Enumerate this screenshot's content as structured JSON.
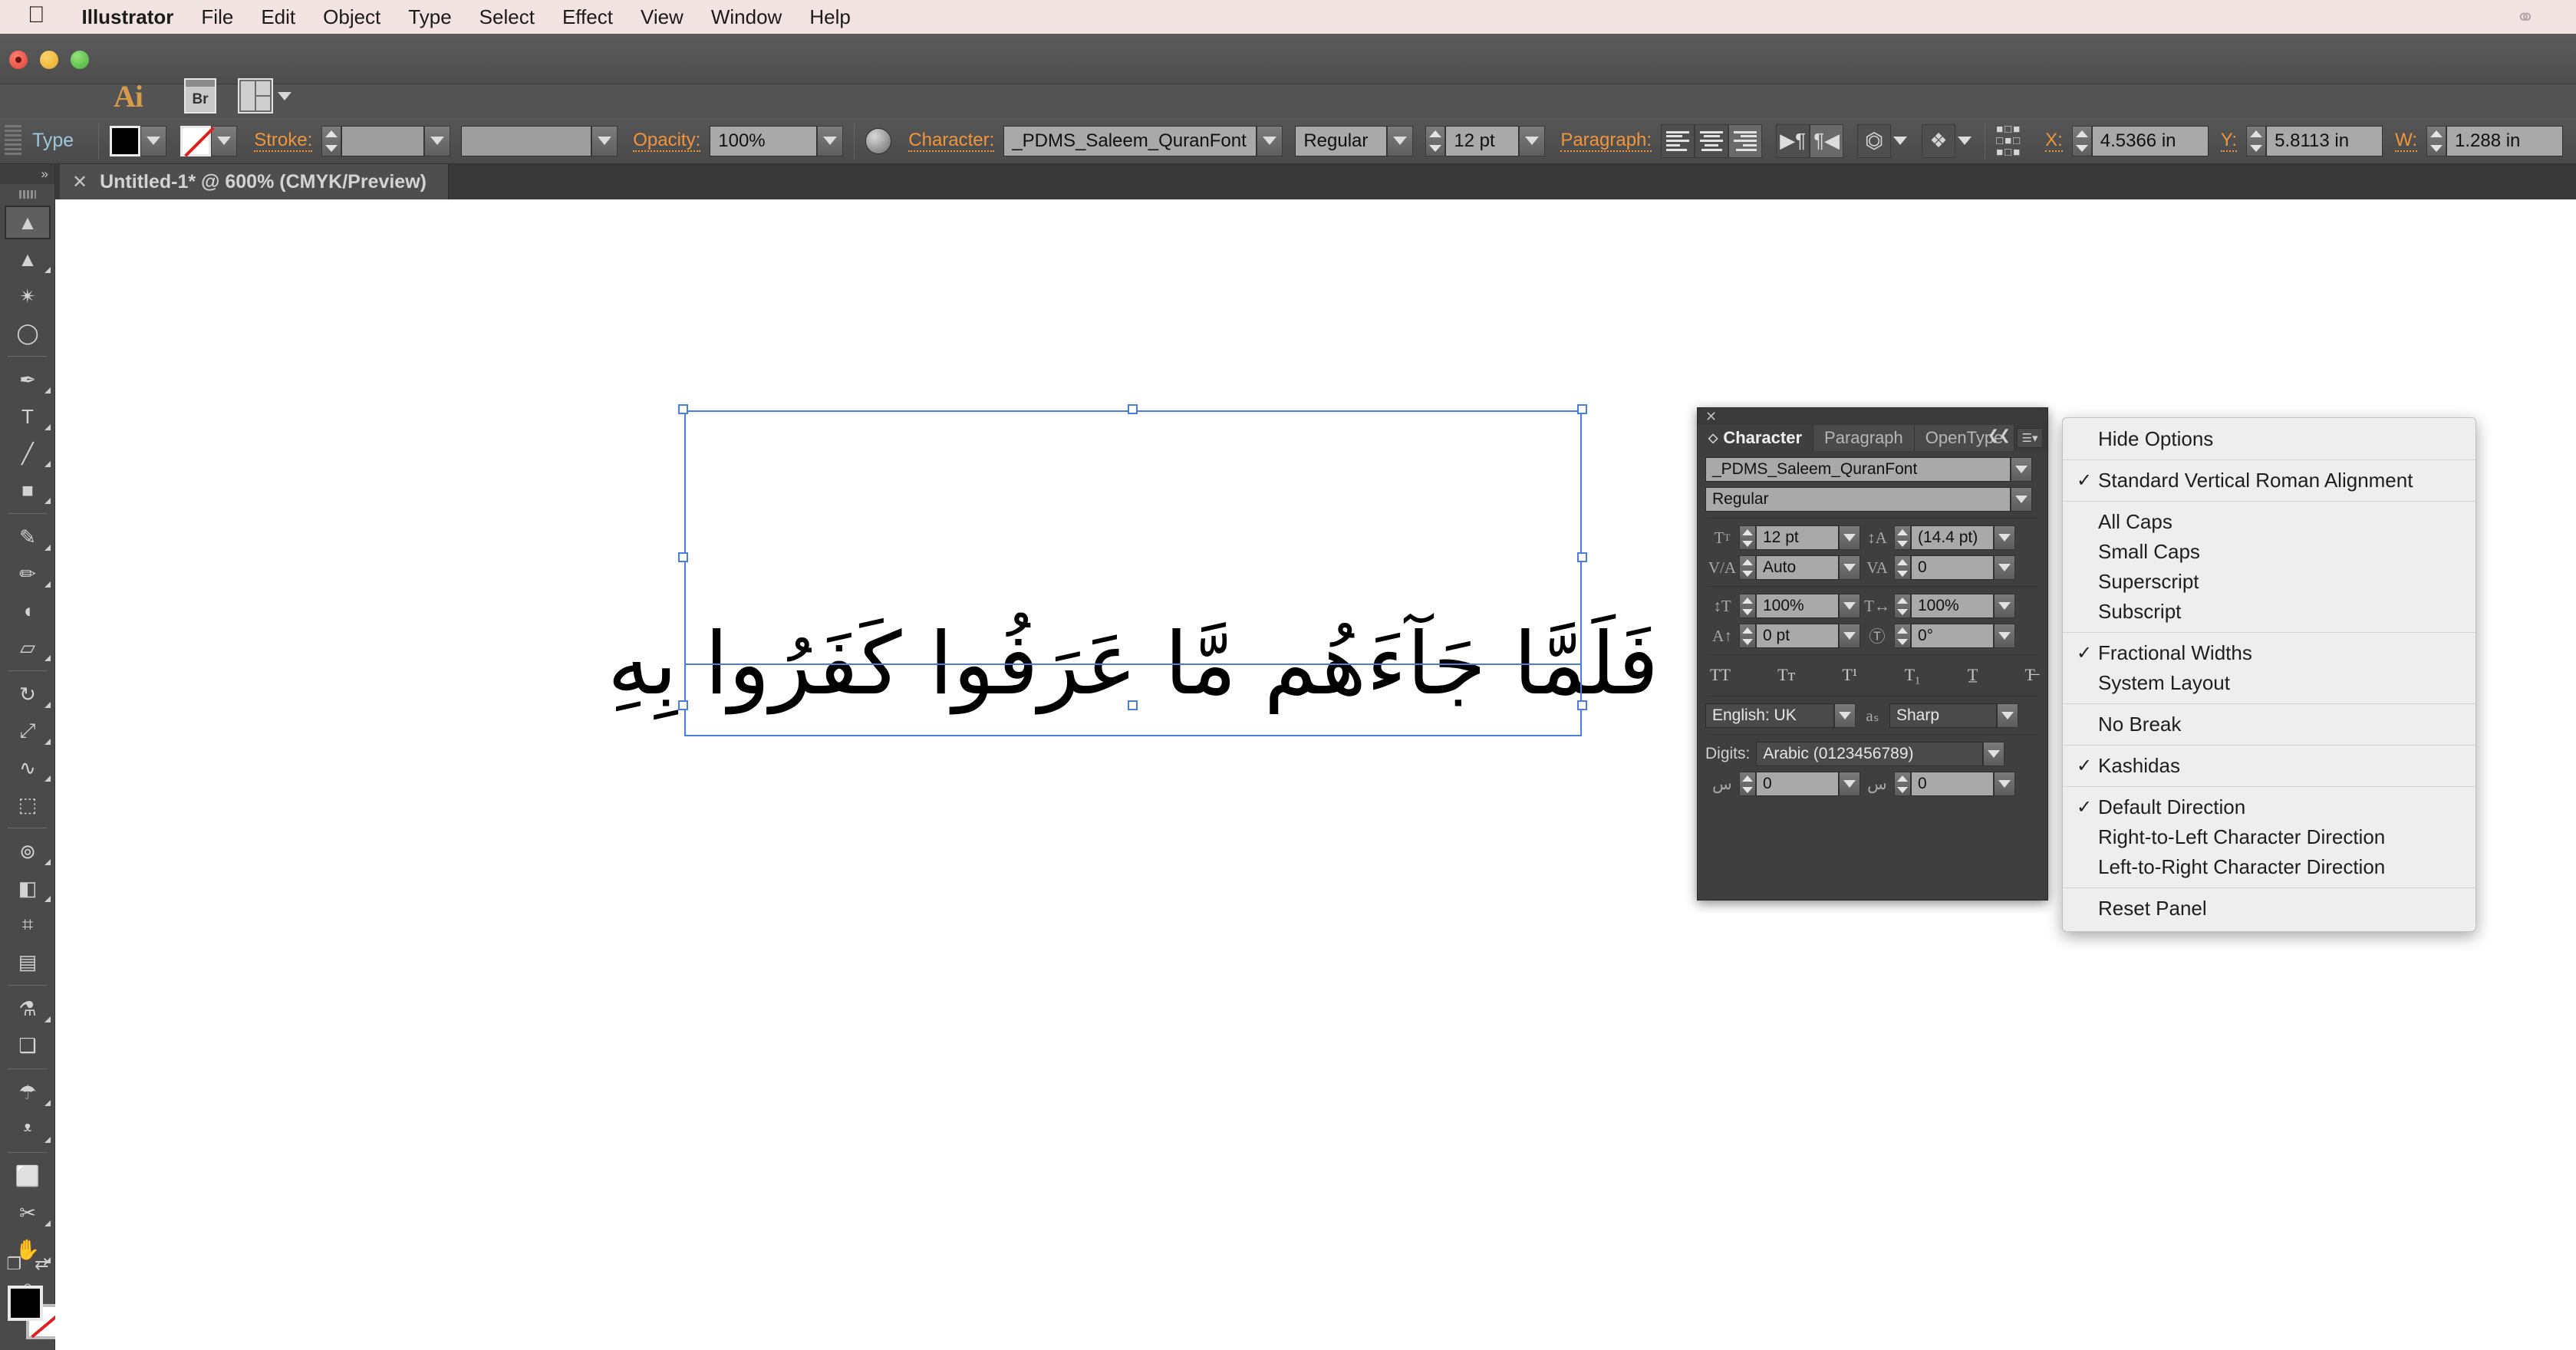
{
  "mac_menubar": {
    "apple_icon": "apple-logo",
    "items": [
      "Illustrator",
      "File",
      "Edit",
      "Object",
      "Type",
      "Select",
      "Effect",
      "View",
      "Window",
      "Help"
    ],
    "status_icon": "creative-cloud-icon"
  },
  "app": {
    "logo": "Ai",
    "bridge_label": "Br",
    "arrange_icon": "arrange-documents-icon"
  },
  "control_bar": {
    "mode_label": "Type",
    "fill_swatch": "#000000",
    "stroke_swatch": "none",
    "stroke_label": "Stroke:",
    "stroke_weight": "",
    "stroke_profile": "",
    "opacity_label": "Opacity:",
    "opacity_value": "100%",
    "character_label": "Character:",
    "font_family": "_PDMS_Saleem_QuranFont",
    "font_style": "Regular",
    "font_size": "12 pt",
    "paragraph_label": "Paragraph:",
    "align_left_icon": "align-left-icon",
    "align_center_icon": "align-center-icon",
    "align_right_icon": "align-right-icon",
    "ltr_paragraph_icon": "ltr-paragraph-direction-icon",
    "rtl_paragraph_icon": "rtl-paragraph-direction-icon",
    "envelope_icon": "make-envelope-icon",
    "transform_icon": "transform-icon",
    "align_grid_icon": "align-panel-icon",
    "x_label": "X:",
    "x_value": "4.5366 in",
    "y_label": "Y:",
    "y_value": "5.8113 in",
    "w_label": "W:",
    "w_value": "1.288 in"
  },
  "document_tab": {
    "close_icon": "close-tab-icon",
    "title": "Untitled-1* @ 600% (CMYK/Preview)"
  },
  "tools": [
    {
      "name": "selection-tool",
      "glyph": "▲",
      "selected": true,
      "has_flyout": false
    },
    {
      "name": "direct-selection-tool",
      "glyph": "▲",
      "selected": false,
      "has_flyout": true
    },
    {
      "name": "magic-wand-tool",
      "glyph": "✴",
      "selected": false,
      "has_flyout": false
    },
    {
      "name": "lasso-tool",
      "glyph": "◯",
      "selected": false,
      "has_flyout": false
    },
    {
      "name": "pen-tool",
      "glyph": "✒",
      "selected": false,
      "has_flyout": true
    },
    {
      "name": "type-tool",
      "glyph": "T",
      "selected": false,
      "has_flyout": true
    },
    {
      "name": "line-segment-tool",
      "glyph": "╱",
      "selected": false,
      "has_flyout": true
    },
    {
      "name": "rectangle-tool",
      "glyph": "■",
      "selected": false,
      "has_flyout": true
    },
    {
      "name": "paintbrush-tool",
      "glyph": "✎",
      "selected": false,
      "has_flyout": true
    },
    {
      "name": "pencil-tool",
      "glyph": "✏",
      "selected": false,
      "has_flyout": true
    },
    {
      "name": "blob-brush-tool",
      "glyph": "◖",
      "selected": false,
      "has_flyout": false
    },
    {
      "name": "eraser-tool",
      "glyph": "▱",
      "selected": false,
      "has_flyout": true
    },
    {
      "name": "rotate-tool",
      "glyph": "↻",
      "selected": false,
      "has_flyout": true
    },
    {
      "name": "scale-tool",
      "glyph": "⤢",
      "selected": false,
      "has_flyout": true
    },
    {
      "name": "width-tool",
      "glyph": "∿",
      "selected": false,
      "has_flyout": true
    },
    {
      "name": "free-transform-tool",
      "glyph": "⬚",
      "selected": false,
      "has_flyout": false
    },
    {
      "name": "shape-builder-tool",
      "glyph": "⊚",
      "selected": false,
      "has_flyout": true
    },
    {
      "name": "perspective-grid-tool",
      "glyph": "◧",
      "selected": false,
      "has_flyout": true
    },
    {
      "name": "mesh-tool",
      "glyph": "⌗",
      "selected": false,
      "has_flyout": false
    },
    {
      "name": "gradient-tool",
      "glyph": "▤",
      "selected": false,
      "has_flyout": false
    },
    {
      "name": "eyedropper-tool",
      "glyph": "⚗",
      "selected": false,
      "has_flyout": true
    },
    {
      "name": "blend-tool",
      "glyph": "❑",
      "selected": false,
      "has_flyout": false
    },
    {
      "name": "symbol-sprayer-tool",
      "glyph": "☂",
      "selected": false,
      "has_flyout": true
    },
    {
      "name": "column-graph-tool",
      "glyph": "ᵜ",
      "selected": false,
      "has_flyout": true
    },
    {
      "name": "artboard-tool",
      "glyph": "⬜",
      "selected": false,
      "has_flyout": false
    },
    {
      "name": "slice-tool",
      "glyph": "✂",
      "selected": false,
      "has_flyout": true
    },
    {
      "name": "hand-tool",
      "glyph": "✋",
      "selected": false,
      "has_flyout": true
    },
    {
      "name": "zoom-tool",
      "glyph": "⌕",
      "selected": false,
      "has_flyout": false
    }
  ],
  "tool_footer": {
    "screen_mode_icon": "screen-mode-icon",
    "swap_fill_stroke_icon": "swap-fill-stroke-icon",
    "fill_color": "#000000",
    "stroke_color": "none"
  },
  "artwork": {
    "arabic_text": "فَلَمَّا جَآءَهُم مَّا عَرَفُوا كَفَرُوا بِهِ",
    "selection_handles": 8
  },
  "character_panel": {
    "close_icon": "close-panel-icon",
    "collapse_icon": "collapse-panel-icon",
    "flyout_icon": "panel-menu-icon",
    "tabs": [
      {
        "label": "Character",
        "active": true
      },
      {
        "label": "Paragraph",
        "active": false
      },
      {
        "label": "OpenType",
        "active": false
      }
    ],
    "font_family": "_PDMS_Saleem_QuranFont",
    "font_style": "Regular",
    "font_size_icon": "font-size-icon",
    "font_size": "12 pt",
    "leading_icon": "leading-icon",
    "leading": "(14.4 pt)",
    "kerning_icon": "kerning-icon",
    "kerning": "Auto",
    "tracking_icon": "tracking-icon",
    "tracking": "0",
    "vertical_scale_icon": "vertical-scale-icon",
    "vertical_scale": "100%",
    "horizontal_scale_icon": "horizontal-scale-icon",
    "horizontal_scale": "100%",
    "baseline_shift_icon": "baseline-shift-icon",
    "baseline_shift": "0 pt",
    "rotation_icon": "character-rotation-icon",
    "rotation": "0°",
    "style_buttons": [
      {
        "name": "all-caps-button",
        "glyph": "TT"
      },
      {
        "name": "small-caps-button",
        "glyph": "Tᴛ"
      },
      {
        "name": "superscript-button",
        "glyph": "T¹"
      },
      {
        "name": "subscript-button",
        "glyph": "T₁"
      },
      {
        "name": "underline-button",
        "glyph": "T̲"
      },
      {
        "name": "strikethrough-button",
        "glyph": "T̶"
      }
    ],
    "language_label": "language-select",
    "language": "English: UK",
    "antialias_icon": "anti-aliasing-icon",
    "antialias": "Sharp",
    "digits_label": "Digits:",
    "digits": "Arabic (0123456789)",
    "kashida_icon": "kashida-icon",
    "kashida_value": "0",
    "diacritic_icon": "diacritic-position-icon",
    "diacritic_value": "0"
  },
  "flyout_menu": {
    "groups": [
      [
        {
          "label": "Hide Options",
          "checked": false
        }
      ],
      [
        {
          "label": "Standard Vertical Roman Alignment",
          "checked": true
        }
      ],
      [
        {
          "label": "All Caps",
          "checked": false
        },
        {
          "label": "Small Caps",
          "checked": false
        },
        {
          "label": "Superscript",
          "checked": false
        },
        {
          "label": "Subscript",
          "checked": false
        }
      ],
      [
        {
          "label": "Fractional Widths",
          "checked": true
        },
        {
          "label": "System Layout",
          "checked": false
        }
      ],
      [
        {
          "label": "No Break",
          "checked": false
        }
      ],
      [
        {
          "label": "Kashidas",
          "checked": true
        }
      ],
      [
        {
          "label": "Default Direction",
          "checked": true
        },
        {
          "label": "Right-to-Left Character Direction",
          "checked": false
        },
        {
          "label": "Left-to-Right Character Direction",
          "checked": false
        }
      ],
      [
        {
          "label": "Reset Panel",
          "checked": false
        }
      ]
    ]
  },
  "colors": {
    "menubar_bg": "#f4e3e3",
    "app_chrome": "#4a4a4a",
    "panel_bg": "#3f3f3f",
    "accent_orange": "#f0953c",
    "selection_blue": "#4a7ede",
    "menu_bg": "#eeeeee"
  }
}
